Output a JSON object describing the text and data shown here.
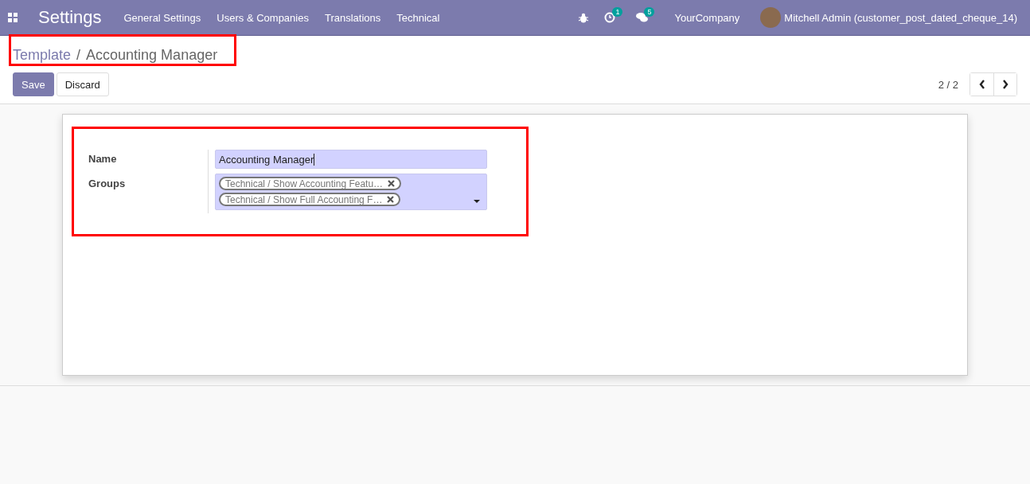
{
  "navbar": {
    "app_title": "Settings",
    "menu": [
      "General Settings",
      "Users & Companies",
      "Translations",
      "Technical"
    ],
    "activity_badge": "1",
    "messages_badge": "5",
    "company": "YourCompany",
    "user": "Mitchell Admin (customer_post_dated_cheque_14)"
  },
  "breadcrumb_separator": "/",
  "breadcrumbs": [
    {
      "label": "Template",
      "kind": "link"
    },
    {
      "label": "Accounting Manager",
      "kind": "current"
    }
  ],
  "buttons": [
    {
      "label": "Save",
      "kind": "primary"
    },
    {
      "label": "Discard",
      "kind": "secondary"
    }
  ],
  "pager": {
    "value": "2 / 2"
  },
  "form": {
    "name_label": "Name",
    "name_value": "Accounting Manager",
    "groups_label": "Groups",
    "groups": [
      "Technical / Show Accounting Featu…",
      "Technical / Show Full Accounting F…"
    ]
  }
}
